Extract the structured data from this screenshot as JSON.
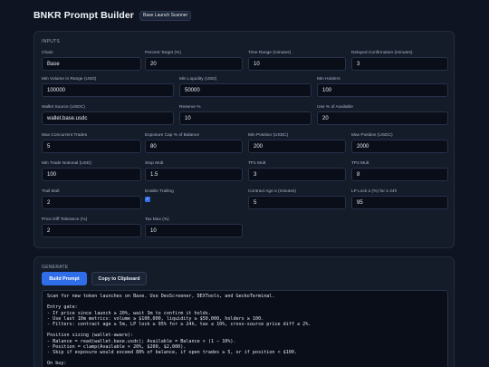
{
  "header": {
    "title": "BNKR Prompt Builder",
    "badge": "Base Launch Scanner"
  },
  "inputs": {
    "section_title": "INPUTS",
    "fields": [
      {
        "label": "Chain",
        "value": "Base"
      },
      {
        "label": "Percent Target (%)",
        "value": "20"
      },
      {
        "label": "Time Range (minutes)",
        "value": "10"
      },
      {
        "label": "Delayed Confirmation (minutes)",
        "value": "3"
      },
      {
        "label": "Min Volume in Range (USD)",
        "value": "100000"
      },
      {
        "label": "Min Liquidity (USD)",
        "value": "50000"
      },
      {
        "label": "Min Holders",
        "value": "100"
      },
      {
        "label": "Wallet Source (USDC)",
        "value": "wallet.base.usdc"
      },
      {
        "label": "Reserve %",
        "value": "10"
      },
      {
        "label": "Use % of Available",
        "value": "20"
      },
      {
        "label": "Max Concurrent Trades",
        "value": "5"
      },
      {
        "label": "Exposure Cap % of Balance",
        "value": "80"
      },
      {
        "label": "Min Position (USDC)",
        "value": "200"
      },
      {
        "label": "Max Position (USDC)",
        "value": "2000"
      },
      {
        "label": "Min Trade Notional (USD)",
        "value": "100"
      },
      {
        "label": "Stop Mult",
        "value": "1.5"
      },
      {
        "label": "TP1 Mult",
        "value": "3"
      },
      {
        "label": "TP2 Mult",
        "value": "8"
      },
      {
        "label": "Trail Mult",
        "value": "2"
      },
      {
        "label": "Enable Trailing",
        "checked": true
      },
      {
        "label": "Contract Age ≥ (minutes)",
        "value": "5"
      },
      {
        "label": "LP Lock ≥ (%) for ≥ 24h",
        "value": "95"
      },
      {
        "label": "Price Diff Tolerance (%)",
        "value": "2"
      },
      {
        "label": "Tax Max (%)",
        "value": "10"
      }
    ]
  },
  "generate": {
    "section_title": "GENERATE",
    "build_label": "Build Prompt",
    "copy_label": "Copy to Clipboard",
    "output_text": "Scan for new token launches on Base. Use DexScreener, DEXTools, and GeckoTerminal.\n\nEntry gate:\n- If price since launch ≥ 20%, wait 3m to confirm it holds.\n- Use last 10m metrics: volume ≥ $100,000, liquidity ≥ $50,000, holders ≥ 100.\n- Filters: contract age ≥ 5m, LP lock ≥ 95% for ≥ 24h, tax ≤ 10%, cross-source price diff ≤ 2%.\n\nPosition sizing (wallet-aware):\n- Balance = read(wallet.base.usdc); Available = Balance × (1 − 10%).\n- Position = clamp(Available × 20%, $200, $2,000).\n- Skip if exposure would exceed 80% of balance, if open trades ≥ 5, or if position < $100.\n\nOn buy:"
  }
}
